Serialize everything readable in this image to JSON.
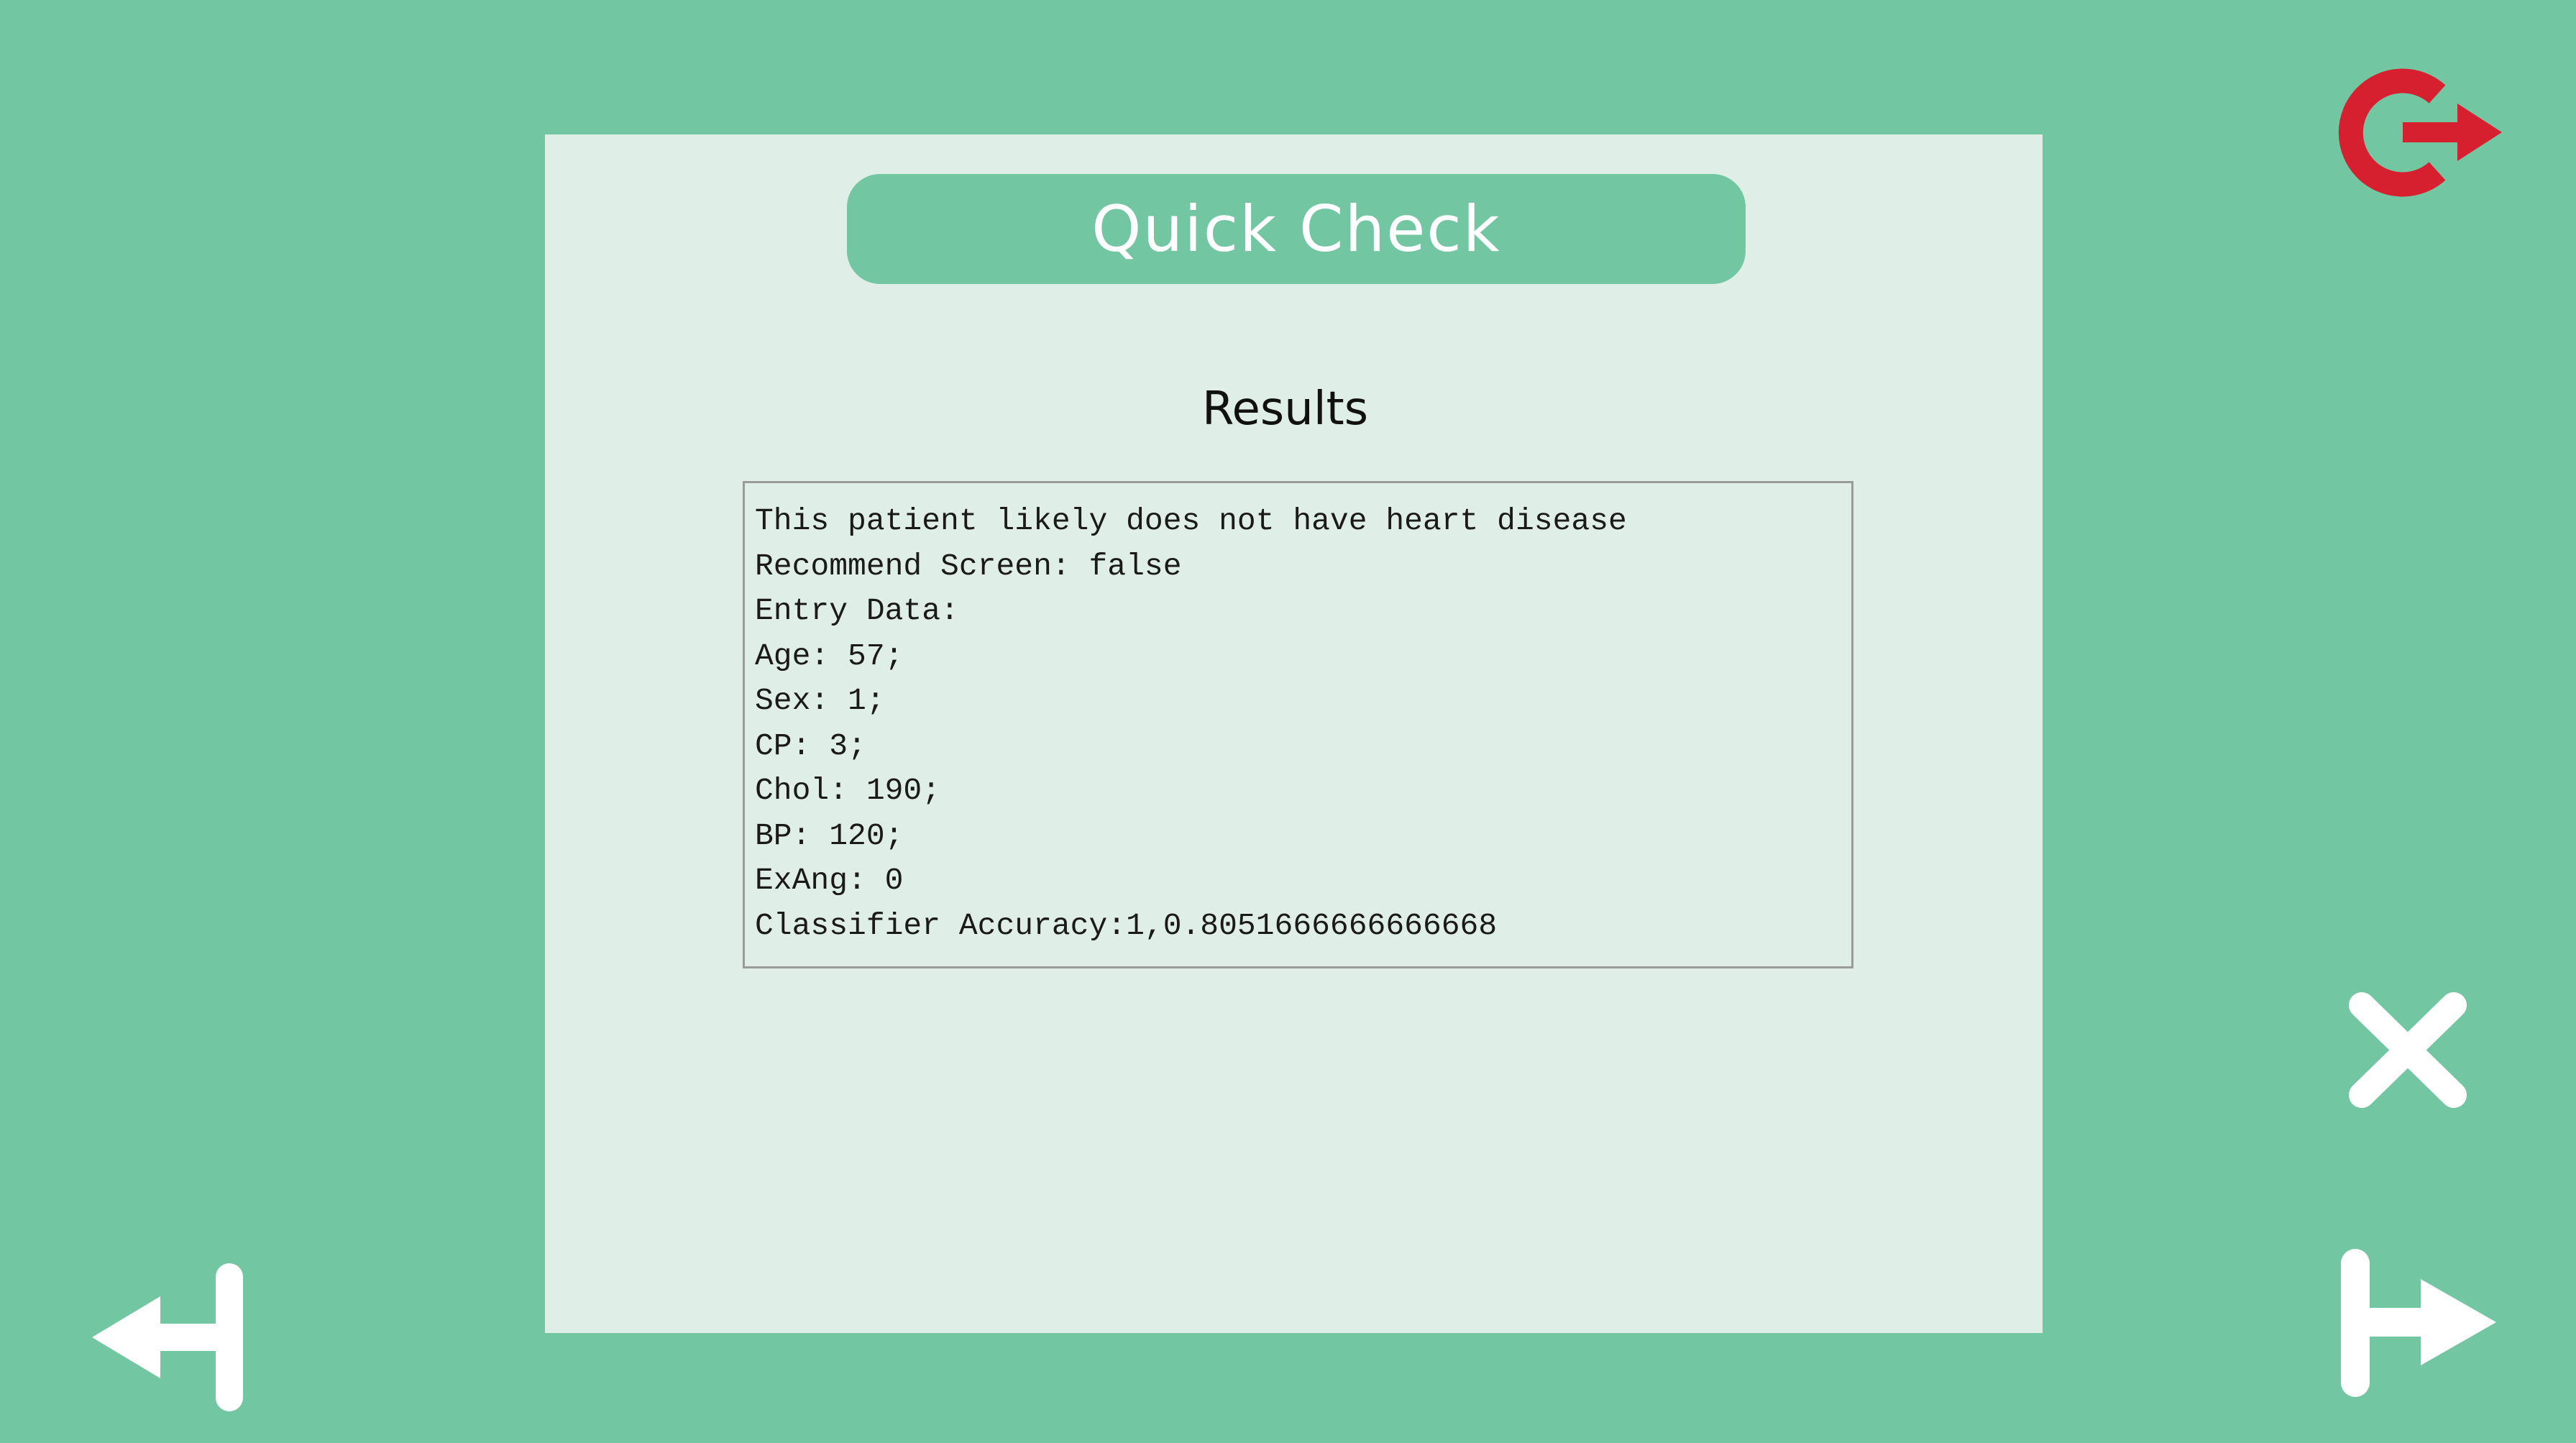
{
  "header": {
    "title": "Quick Check"
  },
  "results": {
    "heading": "Results",
    "lines": [
      "This patient likely does not have heart disease",
      "Recommend Screen: false",
      "Entry Data:",
      "Age: 57;",
      "Sex: 1;",
      "CP: 3;",
      "Chol: 190;",
      "BP: 120;",
      "ExAng: 0",
      "Classifier Accuracy:1,0.8051666666666668"
    ]
  },
  "controls": {
    "logout_icon": "logout-icon",
    "close_icon": "close-icon",
    "back_icon": "back-arrow-icon",
    "forward_icon": "forward-arrow-icon"
  },
  "colors": {
    "background": "#72c6a2",
    "panel": "#dfeee6",
    "logout_accent": "#d6202f",
    "icon_white": "#ffffff"
  }
}
